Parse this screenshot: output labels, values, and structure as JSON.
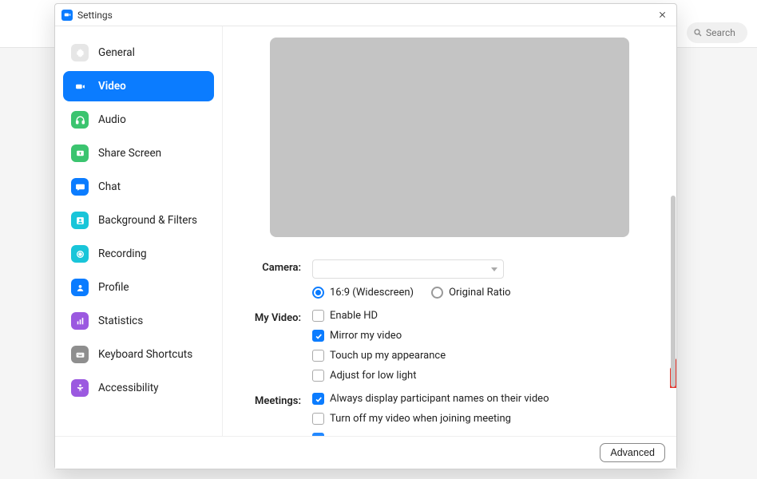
{
  "window": {
    "title": "Settings"
  },
  "search": {
    "placeholder": "Search"
  },
  "sidebar": {
    "items": [
      {
        "label": "General",
        "icon": "gear-icon",
        "color": "#d9d9d9"
      },
      {
        "label": "Video",
        "icon": "video-camera-icon",
        "color": "#ffffff",
        "active": true
      },
      {
        "label": "Audio",
        "icon": "headphones-icon",
        "color": "#3bc46f"
      },
      {
        "label": "Share Screen",
        "icon": "share-screen-icon",
        "color": "#3bc46f"
      },
      {
        "label": "Chat",
        "icon": "chat-bubble-icon",
        "color": "#0b7cff"
      },
      {
        "label": "Background & Filters",
        "icon": "background-icon",
        "color": "#19c5d9"
      },
      {
        "label": "Recording",
        "icon": "record-icon",
        "color": "#19c5d9"
      },
      {
        "label": "Profile",
        "icon": "profile-icon",
        "color": "#0b7cff"
      },
      {
        "label": "Statistics",
        "icon": "statistics-icon",
        "color": "#9b59e0"
      },
      {
        "label": "Keyboard Shortcuts",
        "icon": "keyboard-icon",
        "color": "#8e8e8e"
      },
      {
        "label": "Accessibility",
        "icon": "accessibility-icon",
        "color": "#9b59e0"
      }
    ]
  },
  "video_settings": {
    "camera_label": "Camera:",
    "camera_value": "",
    "ratio": {
      "widescreen": "16:9 (Widescreen)",
      "original": "Original Ratio",
      "selected": "widescreen"
    },
    "my_video_label": "My Video:",
    "options": {
      "enable_hd": {
        "label": "Enable HD",
        "checked": false
      },
      "mirror": {
        "label": "Mirror my video",
        "checked": true
      },
      "touch_up": {
        "label": "Touch up my appearance",
        "checked": false
      },
      "low_light": {
        "label": "Adjust for low light",
        "checked": false
      }
    },
    "meetings_label": "Meetings:",
    "meetings_options": {
      "display_names": {
        "label": "Always display participant names on their video",
        "checked": true
      },
      "turn_off": {
        "label": "Turn off my video when joining meeting",
        "checked": false
      }
    }
  },
  "footer": {
    "advanced": "Advanced"
  },
  "colors": {
    "accent": "#0b7cff",
    "arrow": "#e7352c"
  }
}
